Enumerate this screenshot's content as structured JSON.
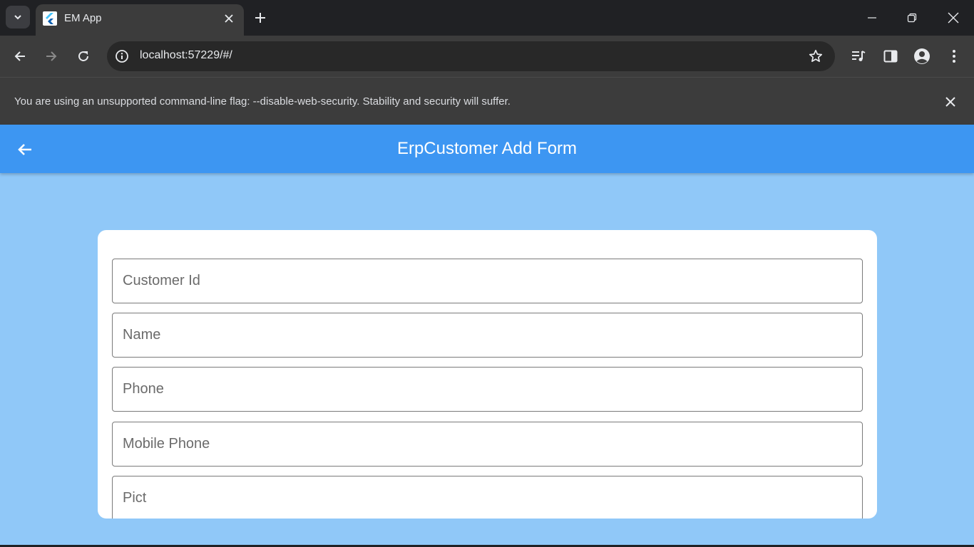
{
  "browser": {
    "tab_title": "EM App",
    "url": "localhost:57229/#/",
    "infobar_text": "You are using an unsupported command-line flag: --disable-web-security. Stability and security will suffer."
  },
  "app": {
    "title": "ErpCustomer Add Form",
    "fields": [
      {
        "placeholder": "Customer Id",
        "value": ""
      },
      {
        "placeholder": "Name",
        "value": ""
      },
      {
        "placeholder": "Phone",
        "value": ""
      },
      {
        "placeholder": "Mobile Phone",
        "value": ""
      },
      {
        "placeholder": "Pict",
        "value": ""
      }
    ]
  },
  "icons": {
    "tab_search": "chevron-down-icon",
    "favicon": "flutter-logo-icon",
    "tab_close": "close-icon",
    "new_tab": "plus-icon",
    "minimize": "minimize-icon",
    "restore": "restore-icon",
    "close_window": "close-icon",
    "back": "arrow-left-icon",
    "forward": "arrow-right-icon",
    "reload": "reload-icon",
    "site_info": "info-icon",
    "bookmark": "star-icon",
    "media": "media-control-icon",
    "side_panel": "side-panel-icon",
    "profile": "profile-icon",
    "menu": "kebab-menu-icon"
  },
  "colors": {
    "appbar": "#3d96f2",
    "app_background": "#90c8f8",
    "card": "#ffffff"
  }
}
